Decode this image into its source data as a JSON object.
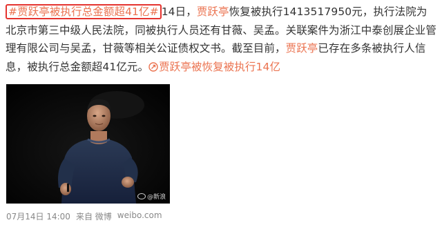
{
  "post": {
    "hashtag_main": "#贾跃亭被执行总金额超41亿#",
    "text_date": "14日，",
    "name1": "贾跃亭",
    "seg1": "恢复被执行1413517950元，执行法院为北京市第三中级人民法院，同被执行人员还有甘薇、吴孟。关联案件为浙江中泰创展企业管理有限公司与吴孟，甘薇等相关公证债权文书。截至目前，",
    "name2": "贾跃亭",
    "seg2": "已存在多条被执行人信息，被执行总金额超41亿元。",
    "link_icon": "link-icon",
    "link_text": "贾跃亭被恢复被执行14亿"
  },
  "image": {
    "watermark": "@新浪"
  },
  "meta": {
    "time": "07月14日 14:00",
    "source_prefix": "来自",
    "source": "微博",
    "site": "weibo.com"
  },
  "colors": {
    "link": "#eb7350",
    "highlight_border": "#e5322d",
    "text": "#333333",
    "meta": "#888888"
  }
}
